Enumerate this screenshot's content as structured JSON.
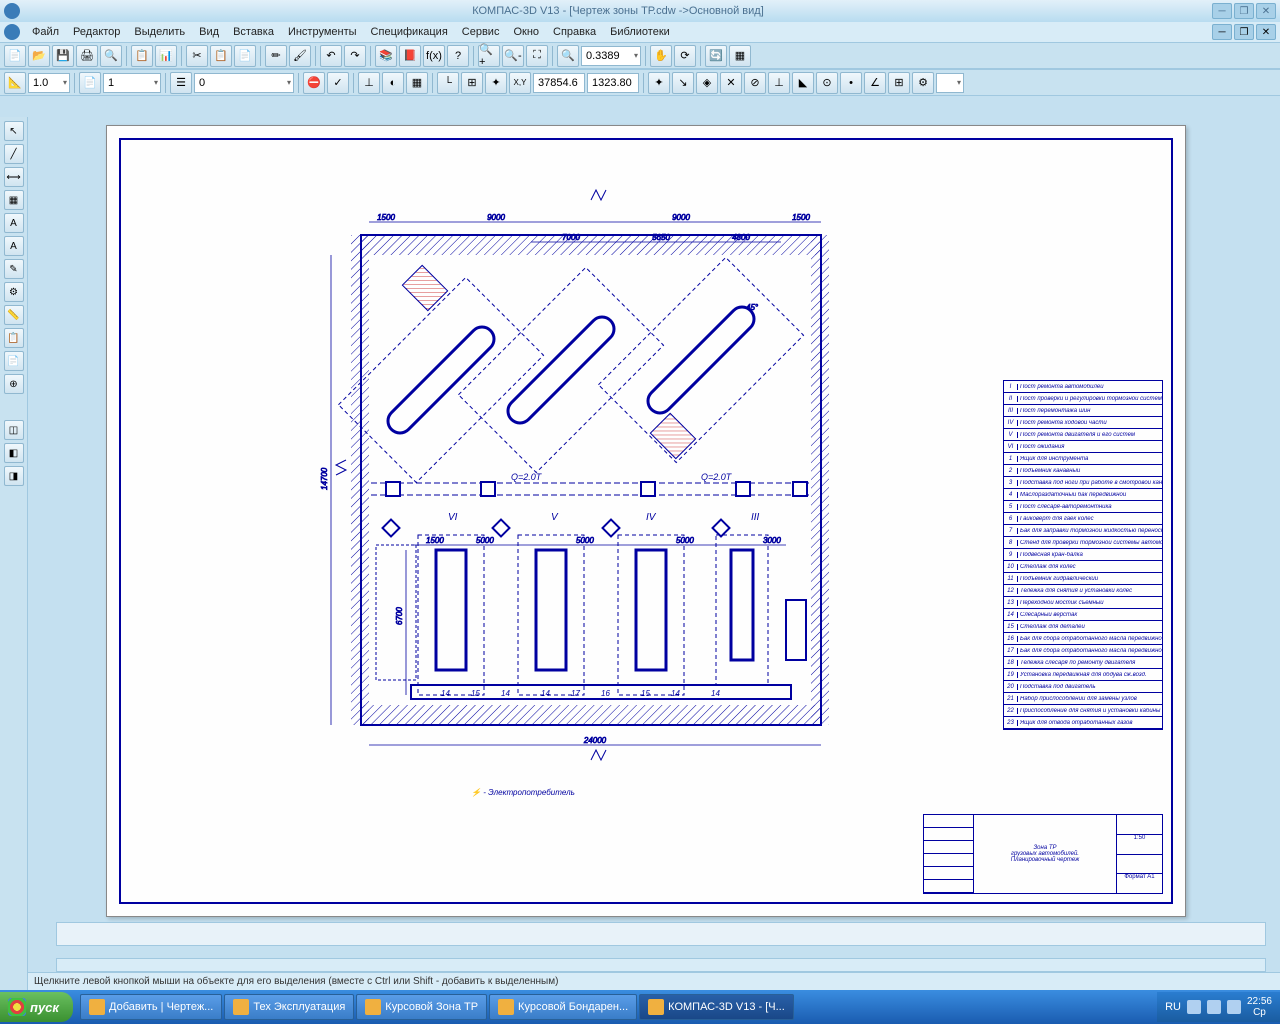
{
  "title": "КОМПАС-3D V13 - [Чертеж зоны ТР.cdw ->Основной вид]",
  "menu": [
    "Файл",
    "Редактор",
    "Выделить",
    "Вид",
    "Вставка",
    "Инструменты",
    "Спецификация",
    "Сервис",
    "Окно",
    "Справка",
    "Библиотеки"
  ],
  "zoom_value": "0.3389",
  "scale1": "1.0",
  "scale2": "1",
  "layer": "0",
  "coord_x": "37854.6",
  "coord_y": "1323.80",
  "status_hint": "Щелкните левой кнопкой мыши на объекте для его выделения (вместе с Ctrl или Shift - добавить к выделенным)",
  "note_text": "- Электропотребитель",
  "crane_label": "Q=2.0Т",
  "dims_top": [
    "1500",
    "9000",
    "9000",
    "1500"
  ],
  "dims_top2": [
    "7000",
    "5650",
    "4800"
  ],
  "dims_bot": [
    "1500",
    "5000",
    "5000",
    "5000",
    "3000"
  ],
  "dim_overall": "24000",
  "dim_height": "14700",
  "dim_h2": "6700",
  "angle": "45°",
  "spec": [
    {
      "n": "I",
      "t": "Пост ремонта автомобилей"
    },
    {
      "n": "II",
      "t": "Пост проверки и регулировки тормозной системы"
    },
    {
      "n": "III",
      "t": "Пост перемонтажа шин"
    },
    {
      "n": "IV",
      "t": "Пост ремонта ходовой части"
    },
    {
      "n": "V",
      "t": "Пост ремонта двигателя и его систем"
    },
    {
      "n": "VI",
      "t": "Пост ожидания"
    },
    {
      "n": "1",
      "t": "Ящик для инструмента"
    },
    {
      "n": "2",
      "t": "Подъемник канавный"
    },
    {
      "n": "3",
      "t": "Подставка под ноги при работе в смотровой канаве"
    },
    {
      "n": "4",
      "t": "Маслораздаточный бак передвижной"
    },
    {
      "n": "5",
      "t": "Пост слесаря-авторемонтника"
    },
    {
      "n": "6",
      "t": "Гайковерт для гаек колес"
    },
    {
      "n": "7",
      "t": "Бак для заправки тормозной жидкостью переносной"
    },
    {
      "n": "8",
      "t": "Стенд для проверки тормозной системы автомобиля"
    },
    {
      "n": "9",
      "t": "Подвесная кран-балка"
    },
    {
      "n": "10",
      "t": "Стеллаж для колес"
    },
    {
      "n": "11",
      "t": "Подъемник гидравлический"
    },
    {
      "n": "12",
      "t": "Тележка для снятия и установки колес"
    },
    {
      "n": "13",
      "t": "Переходной мостик съемный"
    },
    {
      "n": "14",
      "t": "Слесарный верстак"
    },
    {
      "n": "15",
      "t": "Стеллаж для деталей"
    },
    {
      "n": "16",
      "t": "Бак для сбора отработанного масла передвижной"
    },
    {
      "n": "17",
      "t": "Бак для сбора отработанного масла передвижной"
    },
    {
      "n": "18",
      "t": "Тележка слесаря по ремонту двигателя"
    },
    {
      "n": "19",
      "t": "Установка передвижная для обдува сж.возд."
    },
    {
      "n": "20",
      "t": "Подставка под двигатель"
    },
    {
      "n": "21",
      "t": "Набор приспособлений для замены узлов"
    },
    {
      "n": "22",
      "t": "Приспособление для снятия и установки кабины"
    },
    {
      "n": "23",
      "t": "Ящик для отвода отработанных газов"
    }
  ],
  "stamp": {
    "title1": "Зона ТР",
    "title2": "грузовых автомобилей.",
    "title3": "Планировочный чертеж",
    "scale": "1:50",
    "format": "Формат    А1"
  },
  "taskbar": {
    "start": "пуск",
    "items": [
      "Добавить | Чертеж...",
      "Тех Эксплуатация",
      "Курсовой Зона ТР",
      "Курсовой Бондарен...",
      "КОМПАС-3D V13 - [Ч..."
    ],
    "lang": "RU",
    "time": "22:56",
    "day": "Ср"
  }
}
